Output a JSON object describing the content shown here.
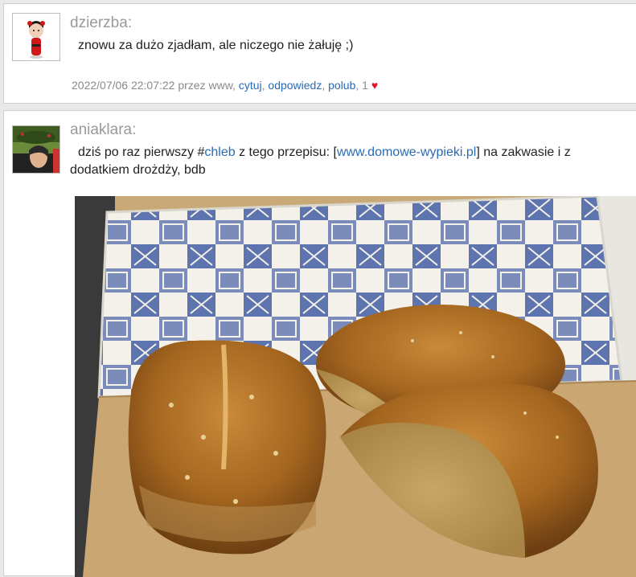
{
  "posts": [
    {
      "author": "dzierzba:",
      "text": "znowu za dużo zjadłam, ale niczego nie żałuję ;)",
      "timestamp": "2022/07/06 22:07:22",
      "by_prefix": "przez",
      "by_user": "www",
      "actions": [
        "cytuj",
        "odpowiedz",
        "polub"
      ],
      "likes": "1",
      "heart": "♥"
    },
    {
      "author": "aniaklara:",
      "text_part1": "dziś po raz pierwszy #",
      "hashtag": "chleb",
      "text_part2": " z tego przepisu: [",
      "link": "www.domowe-wypieki.pl",
      "text_part3": "] na zakwasie i z dodatkiem drożdży, bdb"
    }
  ],
  "colors": {
    "link": "#2a6bb5",
    "author": "#9a9a9a",
    "heart": "#e0182d"
  }
}
